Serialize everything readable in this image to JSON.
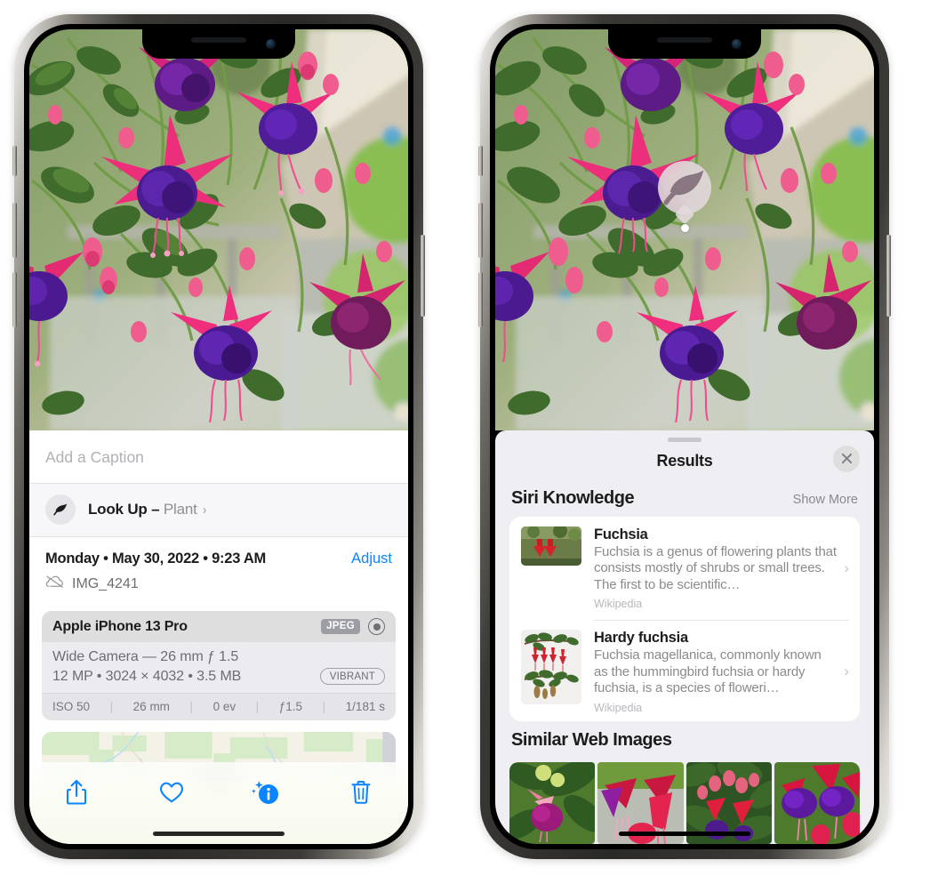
{
  "left_phone": {
    "caption_placeholder": "Add a Caption",
    "lookup": {
      "label": "Look Up –",
      "subject": "Plant",
      "chevron": "›",
      "icon": "leaf-icon"
    },
    "meta": {
      "date": "Monday • May 30, 2022 • 9:23 AM",
      "adjust_label": "Adjust",
      "filename": "IMG_4241",
      "cloud_icon": "icloud-slash-icon"
    },
    "exif": {
      "device": "Apple iPhone 13 Pro",
      "format_chip": "JPEG",
      "raw_icon": "raw-aperture-icon",
      "lens_line": "Wide Camera — 26 mm ƒ 1.5",
      "specs_line": "12 MP • 3024 × 4032 • 3.5 MB",
      "style_chip": "VIBRANT",
      "footer": [
        "ISO 50",
        "26 mm",
        "0 ev",
        "ƒ1.5",
        "1/181 s"
      ]
    },
    "toolbar": [
      {
        "name": "share-button",
        "icon": "share-icon"
      },
      {
        "name": "favorite-button",
        "icon": "heart-icon"
      },
      {
        "name": "info-button",
        "icon": "info-sparkle-icon"
      },
      {
        "name": "delete-button",
        "icon": "trash-icon"
      }
    ],
    "accent_color": "#0a84ff"
  },
  "right_phone": {
    "visual_lookup_badge": {
      "icon": "leaf-icon"
    },
    "sheet": {
      "title": "Results",
      "close_icon": "close-icon",
      "sections": [
        {
          "title": "Siri Knowledge",
          "action_label": "Show More",
          "items": [
            {
              "title": "Fuchsia",
              "description": "Fuchsia is a genus of flowering plants that consists mostly of shrubs or small trees. The first to be scientific…",
              "source": "Wikipedia",
              "chevron": "›"
            },
            {
              "title": "Hardy fuchsia",
              "description": "Fuchsia magellanica, commonly known as the hummingbird fuchsia or hardy fuchsia, is a species of floweri…",
              "source": "Wikipedia",
              "chevron": "›"
            }
          ]
        },
        {
          "title": "Similar Web Images",
          "thumbnails": [
            "web-image-1",
            "web-image-2",
            "web-image-3",
            "web-image-4"
          ]
        }
      ]
    }
  }
}
